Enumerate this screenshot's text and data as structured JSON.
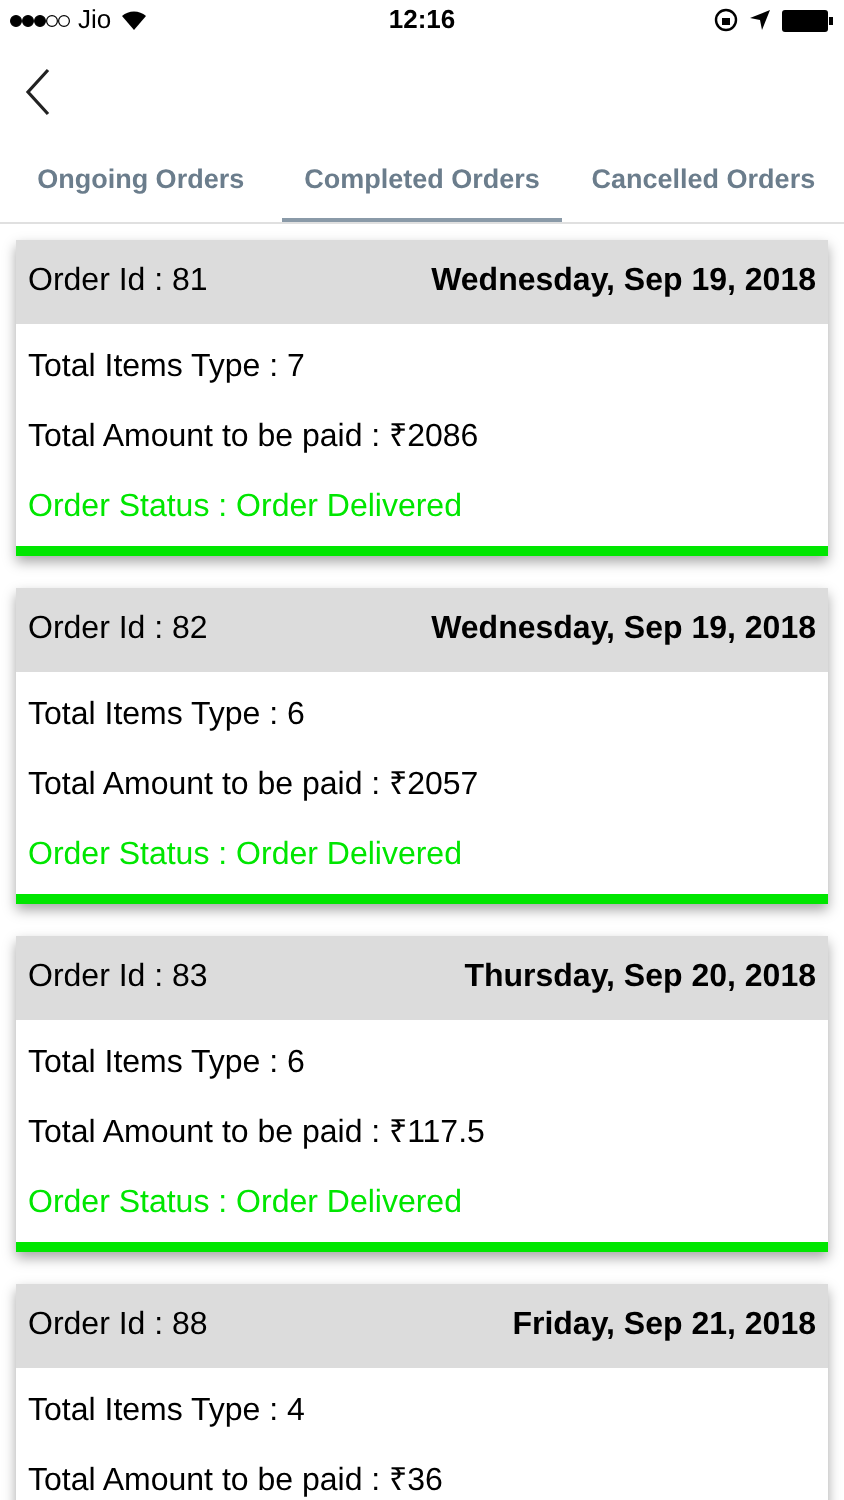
{
  "status_bar": {
    "carrier": "Jio",
    "time": "12:16"
  },
  "tabs": [
    {
      "label": "Ongoing Orders",
      "selected": false
    },
    {
      "label": "Completed Orders",
      "selected": true
    },
    {
      "label": "Cancelled Orders",
      "selected": false
    }
  ],
  "orders": [
    {
      "order_id": "Order Id : 81",
      "date": "Wednesday, Sep 19, 2018",
      "items": "Total Items Type : 7",
      "amount": "Total Amount to be paid : ₹2086",
      "status": "Order Status : Order Delivered",
      "color": "#00e600"
    },
    {
      "order_id": "Order Id : 82",
      "date": "Wednesday, Sep 19, 2018",
      "items": "Total Items Type : 6",
      "amount": "Total Amount to be paid : ₹2057",
      "status": "Order Status : Order Delivered",
      "color": "#00e600"
    },
    {
      "order_id": "Order Id : 83",
      "date": "Thursday, Sep 20, 2018",
      "items": "Total Items Type : 6",
      "amount": "Total Amount to be paid : ₹117.5",
      "status": "Order Status : Order Delivered",
      "color": "#00e600"
    },
    {
      "order_id": "Order Id : 88",
      "date": "Friday, Sep 21, 2018",
      "items": "Total Items Type : 4",
      "amount": "Total Amount to be paid : ₹36"
    }
  ]
}
